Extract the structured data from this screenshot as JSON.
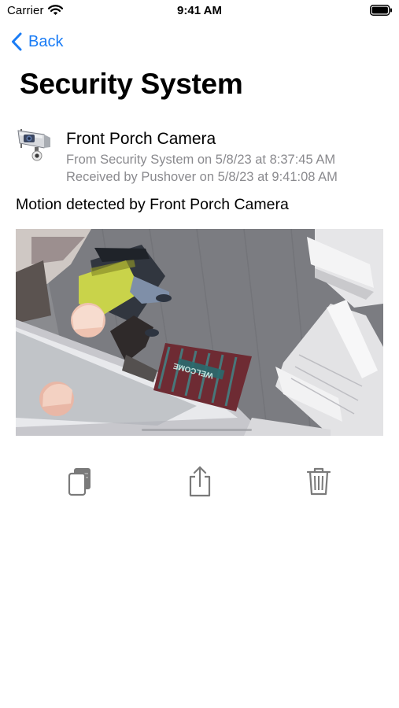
{
  "status_bar": {
    "carrier": "Carrier",
    "time": "9:41 AM",
    "icons": [
      "wifi-icon",
      "battery-icon"
    ]
  },
  "nav": {
    "back_label": "Back",
    "back_icon": "chevron-left-icon"
  },
  "title": "Security System",
  "message": {
    "app_icon": "security-camera-icon",
    "title": "Front Porch Camera",
    "from_line": "From Security System on 5/8/23 at 8:37:45 AM",
    "received_line": "Received by Pushover on 5/8/23 at 9:41:08 AM",
    "body": "Motion detected by Front Porch Camera",
    "attachment": {
      "type": "camera-snapshot",
      "doormat_text": "WELCOME"
    }
  },
  "toolbar": {
    "actions": [
      {
        "name": "copy",
        "icon": "copy-icon"
      },
      {
        "name": "share",
        "icon": "share-icon"
      },
      {
        "name": "delete",
        "icon": "trash-icon"
      }
    ]
  },
  "colors": {
    "accent": "#1a7cf5",
    "secondary_text": "#8a8a8e",
    "toolbar_icon": "#7a7a7a"
  }
}
